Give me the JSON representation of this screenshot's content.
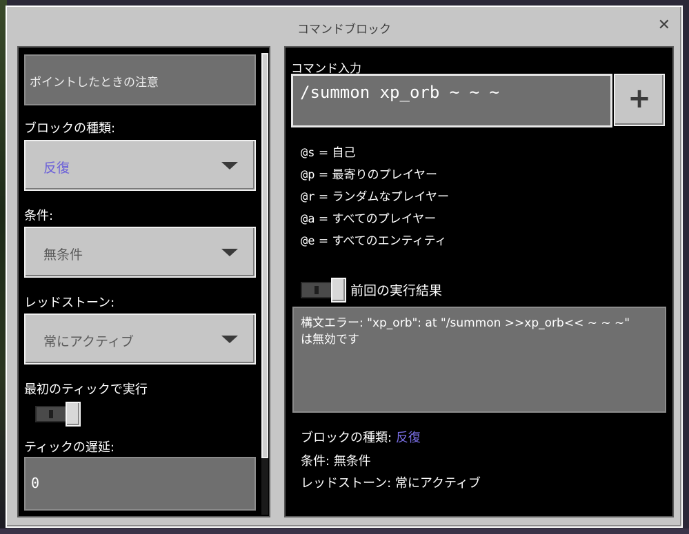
{
  "window": {
    "title": "コマンドブロック",
    "close_glyph": "✕"
  },
  "left": {
    "hover_note_placeholder": "ポイントしたときの注意",
    "block_type_label": "ブロックの種類:",
    "block_type_value": "反復",
    "condition_label": "条件:",
    "condition_value": "無条件",
    "redstone_label": "レッドストーン:",
    "redstone_value": "常にアクティブ",
    "execute_first_tick_label": "最初のティックで実行",
    "execute_first_tick_on": false,
    "tick_delay_label": "ティックの遅延:",
    "tick_delay_value": "0"
  },
  "right": {
    "command_input_label": "コマンド入力",
    "command_value": "/summon xp_orb ~ ~ ~",
    "plus_glyph": "+",
    "hints": [
      {
        "key": "@s",
        "eq": "=",
        "desc": "自己"
      },
      {
        "key": "@p",
        "eq": "=",
        "desc": "最寄りのプレイヤー"
      },
      {
        "key": "@r",
        "eq": "=",
        "desc": "ランダムなプレイヤー"
      },
      {
        "key": "@a",
        "eq": "=",
        "desc": "すべてのプレイヤー"
      },
      {
        "key": "@e",
        "eq": "=",
        "desc": "すべてのエンティティ"
      }
    ],
    "previous_output_label": "前回の実行結果",
    "previous_output_on": false,
    "previous_output_line1": "構文エラー: \"xp_orb\": at \"/summon >>xp_orb<< ~ ~ ~\"",
    "previous_output_line2": "は無効です",
    "summary": {
      "block_type_label": "ブロックの種類:",
      "block_type_value": "反復",
      "condition_label": "条件:",
      "condition_value": "無条件",
      "redstone_label": "レッドストーン:",
      "redstone_value": "常にアクティブ"
    }
  },
  "colors": {
    "accent": "#7a6fe6",
    "panel_bg": "#000000",
    "window_bg": "#c6c6c6"
  },
  "icons": {
    "dropdown": "chevron-down-icon",
    "close": "close-icon",
    "add": "plus-icon"
  }
}
